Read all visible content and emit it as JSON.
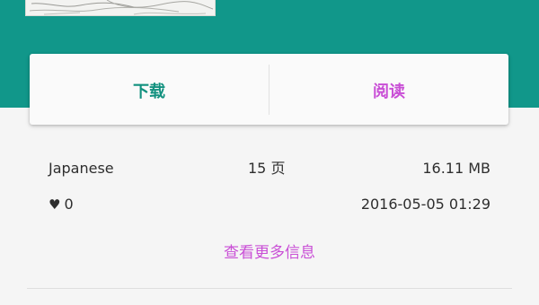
{
  "gallery": {
    "actions": {
      "download_label": "下载",
      "read_label": "阅读"
    },
    "info": {
      "language": "Japanese",
      "pages": "15 页",
      "size": "16.11 MB",
      "favorites": "0",
      "posted": "2016-05-05 01:29"
    },
    "more_info_label": "查看更多信息"
  },
  "colors": {
    "header_band": "#11978a",
    "download_text": "#12917f",
    "read_text": "#c94fd6",
    "link_text": "#c94fd6",
    "background": "#f5f5f5",
    "card": "#fafafa"
  },
  "icons": {
    "favorite": "heart-icon"
  }
}
